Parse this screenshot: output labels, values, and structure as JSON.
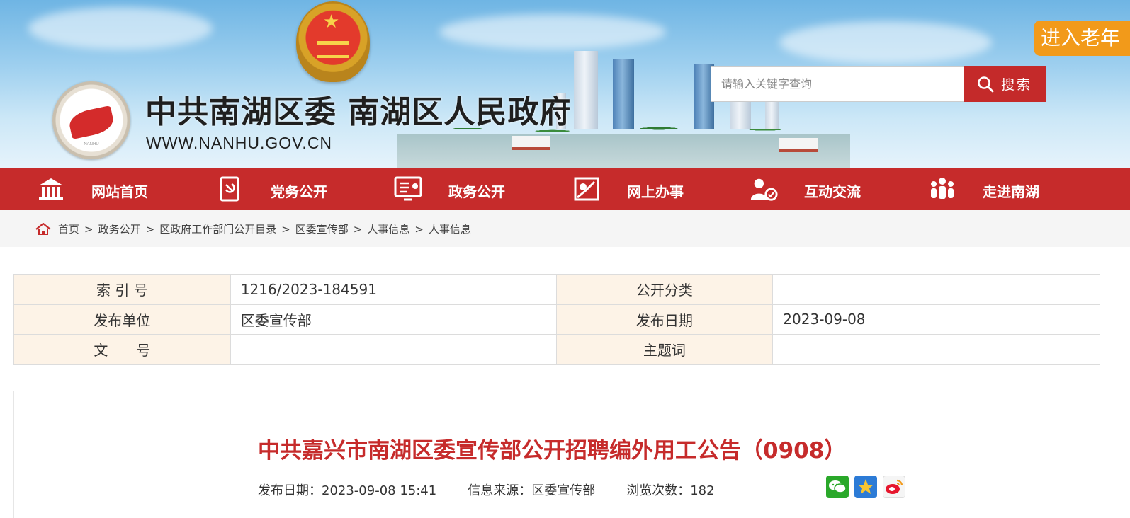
{
  "header": {
    "site_title": "中共南湖区委 南湖区人民政府",
    "site_url": "WWW.NANHU.GOV.CN",
    "elder_mode_label": "进入老年",
    "search_placeholder": "请输入关键字查询",
    "search_button": "搜索"
  },
  "nav": {
    "items": [
      {
        "label": "网站首页",
        "icon": "temple-icon"
      },
      {
        "label": "党务公开",
        "icon": "party-flag-icon"
      },
      {
        "label": "政务公开",
        "icon": "monitor-list-icon"
      },
      {
        "label": "网上办事",
        "icon": "online-service-icon"
      },
      {
        "label": "互动交流",
        "icon": "user-chat-icon"
      },
      {
        "label": "走进南湖",
        "icon": "people-group-icon"
      }
    ],
    "color": "#c62b2b"
  },
  "breadcrumb": [
    "首页",
    "政务公开",
    "区政府工作部门公开目录",
    "区委宣传部",
    "人事信息",
    "人事信息"
  ],
  "meta": {
    "index_no_label": "索 引 号",
    "index_no": "1216/2023-184591",
    "category_label": "公开分类",
    "category": "",
    "publisher_label": "发布单位",
    "publisher": "区委宣传部",
    "publish_date_label": "发布日期",
    "publish_date": "2023-09-08",
    "doc_no_label": "文　　号",
    "doc_no": "",
    "keywords_label": "主题词",
    "keywords": ""
  },
  "article": {
    "title": "中共嘉兴市南湖区委宣传部公开招聘编外用工公告（0908）",
    "date": "发布日期：2023-09-08 15:41",
    "source": "信息来源：区委宣传部",
    "views": "浏览次数：182",
    "share_icons": [
      "wechat-icon",
      "qzone-icon",
      "weibo-icon"
    ]
  },
  "colors": {
    "accent": "#c62b2b",
    "elder": "#f29a1a",
    "meta_key_bg": "#fdf3e7"
  }
}
